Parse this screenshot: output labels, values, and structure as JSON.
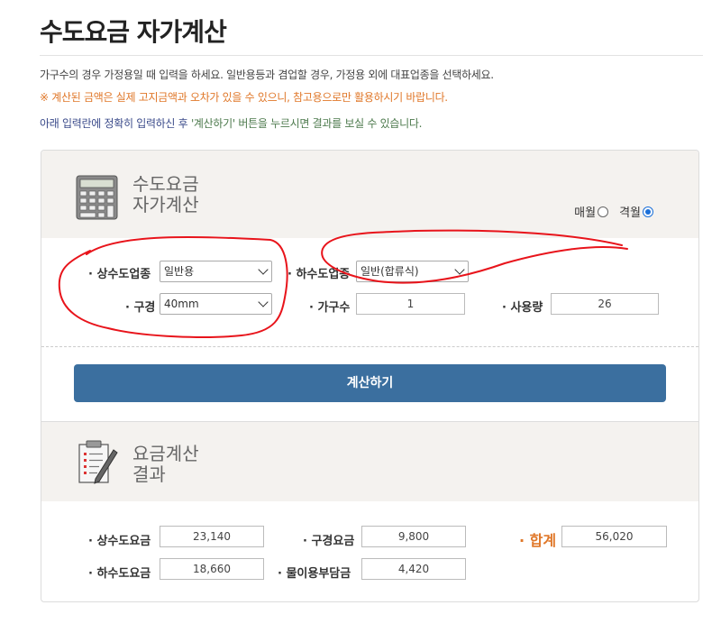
{
  "page": {
    "title": "수도요금 자가계산",
    "note1": "가구수의 경우 가정용일 때 입력을 하세요. 일반용등과 겸업할 경우, 가정용 외에 대표업종을 선택하세요.",
    "note2": "※ 계산된 금액은 실제 고지금액과 오차가 있을 수 있으니, 참고용으로만 활용하시기 바랍니다.",
    "note3_a": "아래 입력란에 정확히 입력하신 후 ",
    "note3_b": "'계산하기' 버튼을 누르시면 결과를 보실 수 있습니다."
  },
  "calculator": {
    "title_line1": "수도요금",
    "title_line2": "자가계산",
    "period": {
      "monthly_label": "매월",
      "bimonthly_label": "격월",
      "selected": "격월"
    },
    "fields": {
      "water_type_label": "· 상수도업종",
      "water_type_value": "일반용",
      "sewer_type_label": "· 하수도업종",
      "sewer_type_value": "일반(합류식)",
      "diameter_label": "· 구경",
      "diameter_value": "40mm",
      "households_label": "· 가구수",
      "households_value": "1",
      "usage_label": "· 사용량",
      "usage_value": "26"
    },
    "calc_button": "계산하기"
  },
  "result": {
    "title_line1": "요금계산",
    "title_line2": "결과",
    "water_fee_label": "· 상수도요금",
    "water_fee_value": "23,140",
    "diameter_fee_label": "· 구경요금",
    "diameter_fee_value": "9,800",
    "total_label": "· 합계",
    "total_value": "56,020",
    "sewer_fee_label": "· 하수도요금",
    "sewer_fee_value": "18,660",
    "water_charge_label": "· 물이용부담금",
    "water_charge_value": "4,420"
  },
  "colors": {
    "accent_button": "#3b6f9f",
    "warning_orange": "#e0782a",
    "annotation_red": "#e8141b",
    "radio_blue": "#1a6fd8"
  }
}
